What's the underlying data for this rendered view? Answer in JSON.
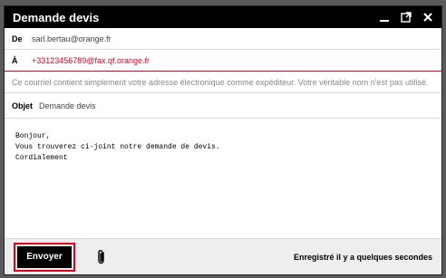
{
  "window": {
    "title": "Demande devis"
  },
  "header": {
    "from_label": "De",
    "from_value": "sarl.bertau@orange.fr",
    "to_label": "À",
    "to_value": "+33123456789@fax.qf.orange.fr",
    "sender_note": "Ce courriel contient simplement votre adresse électronique comme expéditeur. Votre véritable nom n'est pas utilisé.",
    "subject_label": "Objet",
    "subject_value": "Demande devis"
  },
  "body": {
    "text": "Bonjour,\nVous trouverez ci-joint notre demande de devis.\nCordialement"
  },
  "footer": {
    "send_label": "Envoyer",
    "saved_status": "Enregistré il y a quelques secondes"
  },
  "colors": {
    "accent": "#e0001b",
    "titlebar": "#000000"
  }
}
